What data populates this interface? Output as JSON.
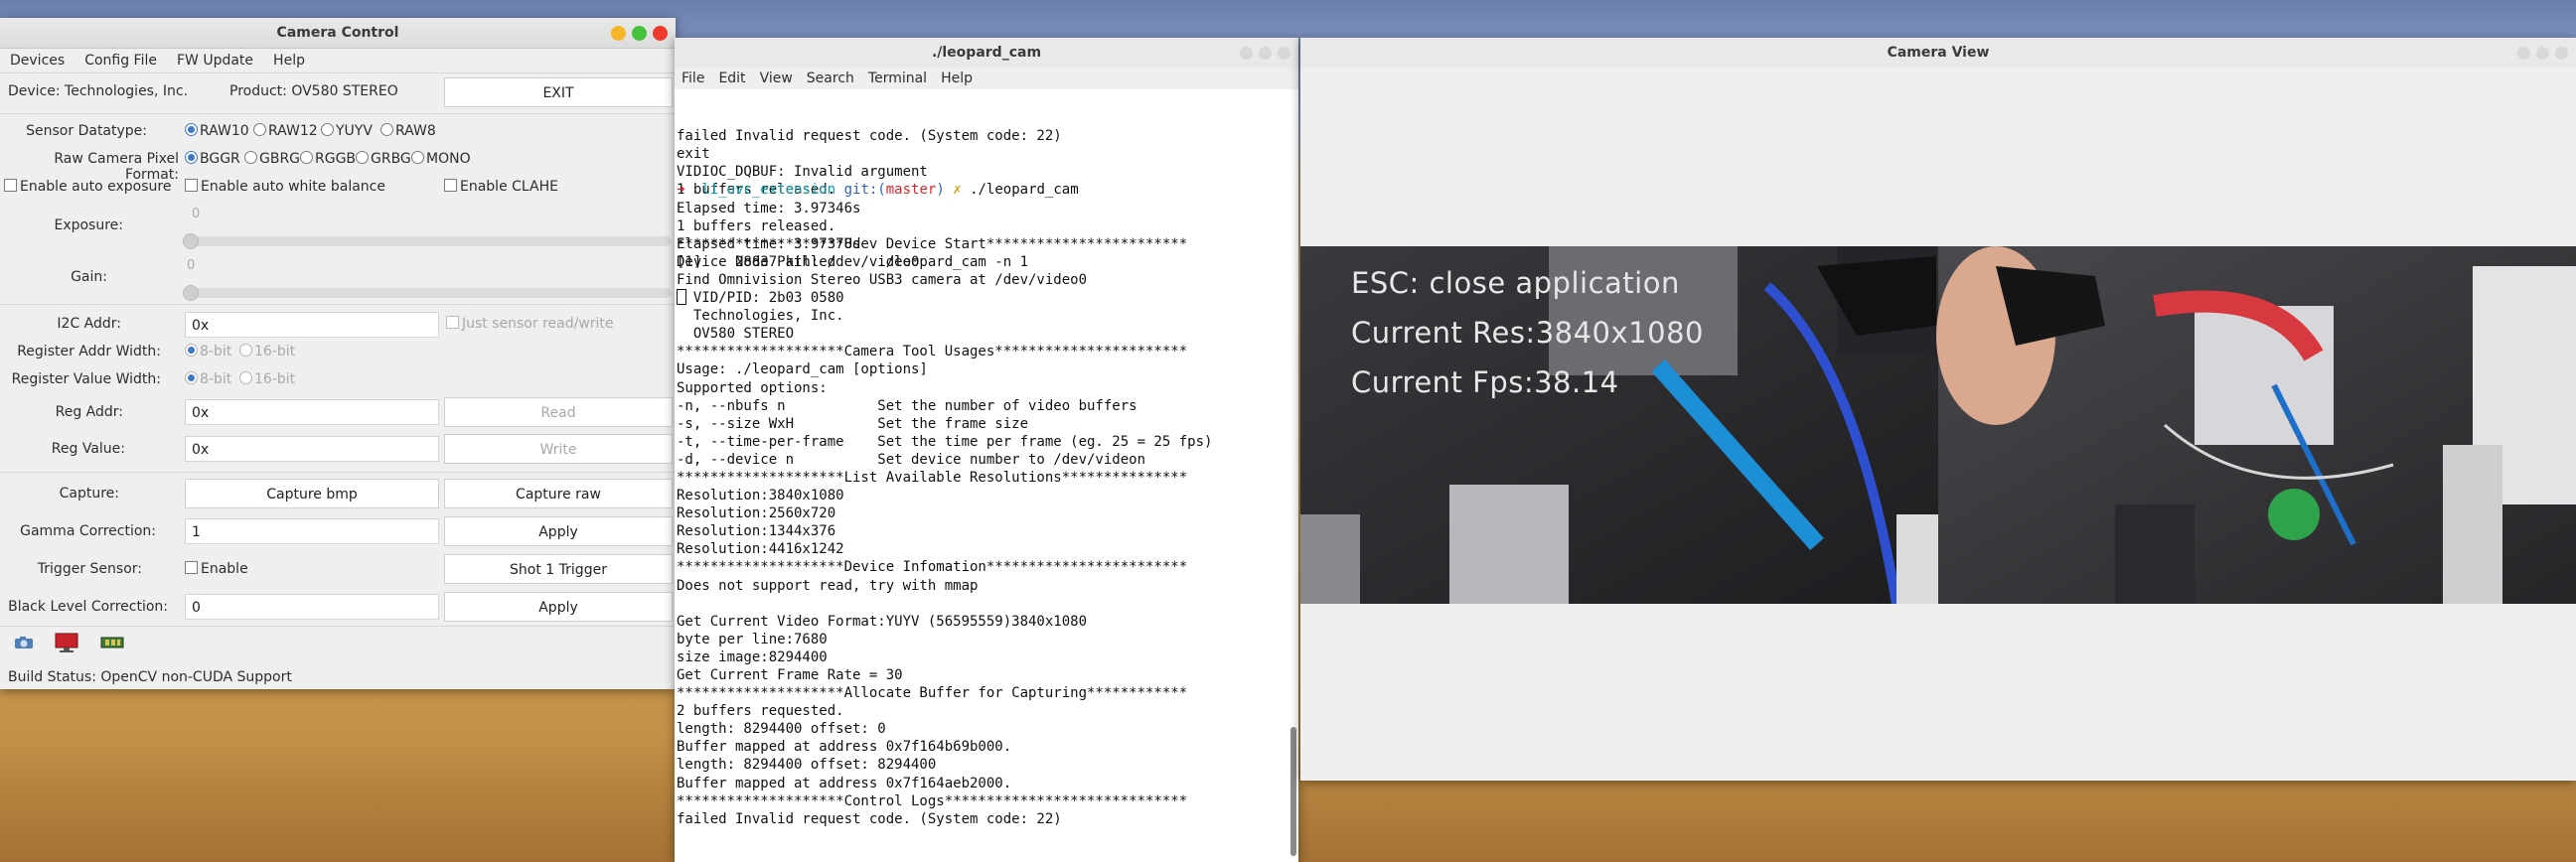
{
  "camera_control": {
    "title": "Camera Control",
    "menu": [
      "Devices",
      "Config File",
      "FW Update",
      "Help"
    ],
    "device_label": "Device: Technologies, Inc.",
    "product_label": "Product: OV580 STEREO",
    "exit_button": "EXIT",
    "sensor_datatype": {
      "label": "Sensor Datatype:",
      "options": [
        "RAW10",
        "RAW12",
        "YUYV",
        "RAW8"
      ],
      "selected": "RAW10"
    },
    "pixel_format": {
      "label": "Raw Camera Pixel Format:",
      "options": [
        "BGGR",
        "GBRG",
        "RGGB",
        "GRBG",
        "MONO"
      ],
      "selected": "BGGR"
    },
    "auto_exposure": "Enable auto exposure",
    "auto_white_balance": "Enable auto white balance",
    "clahe": "Enable CLAHE",
    "exposure": {
      "label": "Exposure:",
      "value": "0"
    },
    "gain": {
      "label": "Gain:",
      "value": "0"
    },
    "i2c_addr": {
      "label": "I2C Addr:",
      "value": "0x"
    },
    "just_sensor": "Just sensor read/write",
    "reg_addr_width": {
      "label": "Register Addr Width:",
      "options": [
        "8-bit",
        "16-bit"
      ]
    },
    "reg_value_width": {
      "label": "Register Value Width:",
      "options": [
        "8-bit",
        "16-bit"
      ]
    },
    "reg_addr": {
      "label": "Reg Addr:",
      "value": "0x",
      "button": "Read"
    },
    "reg_value": {
      "label": "Reg Value:",
      "value": "0x",
      "button": "Write"
    },
    "capture": {
      "label": "Capture:",
      "bmp": "Capture bmp",
      "raw": "Capture raw"
    },
    "gamma": {
      "label": "Gamma Correction:",
      "value": "1",
      "button": "Apply"
    },
    "trigger": {
      "label": "Trigger Sensor:",
      "enable": "Enable",
      "button": "Shot 1 Trigger"
    },
    "black_level": {
      "label": "Black Level Correction:",
      "value": "0",
      "button": "Apply"
    },
    "build_status": "Build Status: OpenCV non-CUDA Support"
  },
  "terminal": {
    "title": "./leopard_cam",
    "menu": [
      "File",
      "Edit",
      "View",
      "Search",
      "Terminal",
      "Help"
    ],
    "prompt": {
      "arrow": "➜",
      "dir": "li_uvc_extension",
      "git": "git:(",
      "branch": "master",
      "close": ")",
      "mark": "✗",
      "cmd": "./leopard_cam"
    },
    "lines_before": [
      "failed Invalid request code. (System code: 22)",
      "exit",
      "VIDIOC_DQBUF: Invalid argument",
      "1 buffers released.",
      "Elapsed time: 3.97346s",
      "1 buffers released.",
      "Elapsed time: 3.97378s",
      "[1]    28837 killed     ./leopard_cam -n 1"
    ],
    "lines_after": [
      "********************Udev Device Start************************",
      "Device Node Path: /dev/video0",
      "Find Omnivision Stereo USB3 camera at /dev/video0",
      "  VID/PID: 2b03 0580",
      "  Technologies, Inc.",
      "  OV580 STEREO",
      "********************Camera Tool Usages***********************",
      "Usage: ./leopard_cam [options]",
      "Supported options:",
      "-n, --nbufs n           Set the number of video buffers",
      "-s, --size WxH          Set the frame size",
      "-t, --time-per-frame    Set the time per frame (eg. 25 = 25 fps)",
      "-d, --device n          Set device number to /dev/videon",
      "********************List Available Resolutions***************",
      "Resolution:3840x1080",
      "Resolution:2560x720",
      "Resolution:1344x376",
      "Resolution:4416x1242",
      "********************Device Infomation************************",
      "Does not support read, try with mmap",
      "",
      "Get Current Video Format:YUYV (56595559)3840x1080",
      "byte per line:7680",
      "size image:8294400",
      "Get Current Frame Rate = 30",
      "********************Allocate Buffer for Capturing************",
      "2 buffers requested.",
      "length: 8294400 offset: 0",
      "Buffer mapped at address 0x7f164b69b000.",
      "length: 8294400 offset: 8294400",
      "Buffer mapped at address 0x7f164aeb2000.",
      "********************Control Logs*****************************",
      "failed Invalid request code. (System code: 22)"
    ]
  },
  "camera_view": {
    "title": "Camera View",
    "overlay": {
      "line1": "ESC: close application",
      "line2": "Current Res:3840x1080",
      "line3": "Current Fps:38.14"
    }
  },
  "colors": {
    "accent": "#3f78c4",
    "close": "#ee3a2c",
    "minimize": "#f5b52a",
    "maximize": "#44c23c"
  },
  "icons": [
    "camera-icon",
    "monitor-icon",
    "chip-icon"
  ]
}
